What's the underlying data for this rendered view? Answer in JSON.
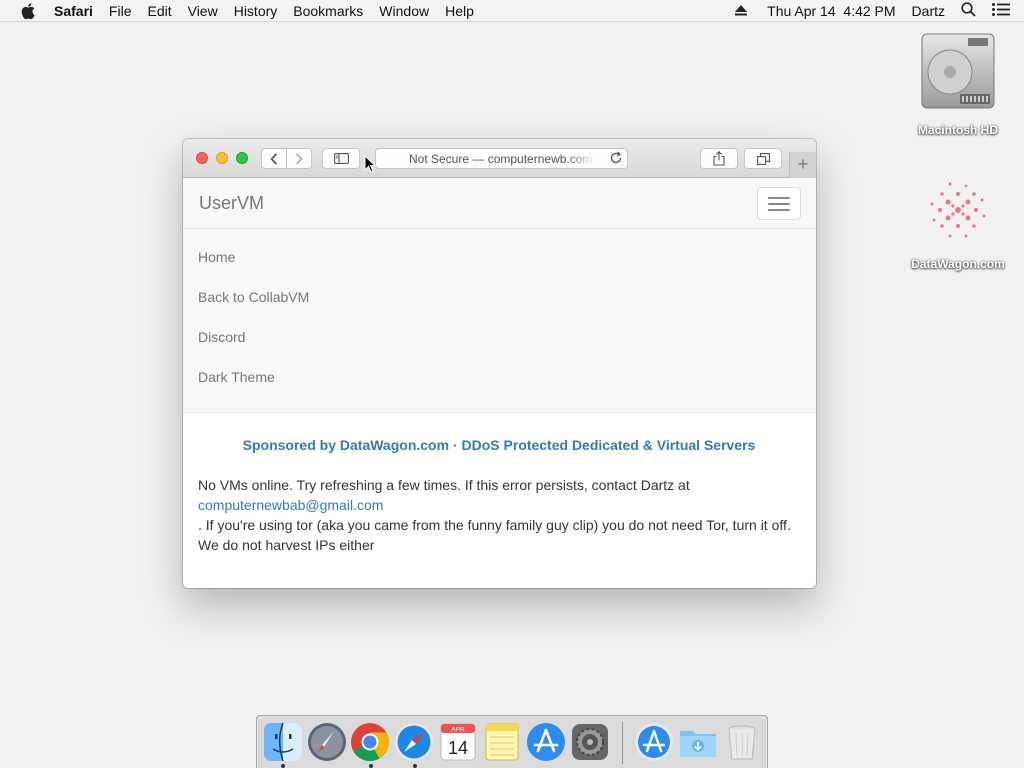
{
  "menubar": {
    "app_name": "Safari",
    "items": [
      "File",
      "Edit",
      "View",
      "History",
      "Bookmarks",
      "Window",
      "Help"
    ],
    "clock": "Thu Apr 14  4:42 PM",
    "user": "Dartz"
  },
  "desktop": {
    "hd_label": "Macintosh HD",
    "datawagon_label": "DataWagon.com"
  },
  "browser": {
    "url_text": "Not Secure — computernewb.com"
  },
  "page": {
    "brand": "UserVM",
    "nav_links": [
      "Home",
      "Back to CollabVM",
      "Discord",
      "Dark Theme"
    ],
    "sponsor": "Sponsored by DataWagon.com · DDoS Protected Dedicated & Virtual Servers",
    "message_before": "No VMs online. Try refreshing a few times. If this error persists, contact Dartz at",
    "email": "computernewbab@gmail.com",
    "message_after": ". If you're using tor (aka you came from the funny family guy clip) you do not need Tor, turn it off. We do not harvest IPs either"
  },
  "dock": {
    "calendar_month": "APR",
    "calendar_day": "14"
  },
  "colors": {
    "link": "#337ab7",
    "close": "#fc5f57",
    "minimize": "#fdbc2e",
    "maximize": "#28c840"
  }
}
